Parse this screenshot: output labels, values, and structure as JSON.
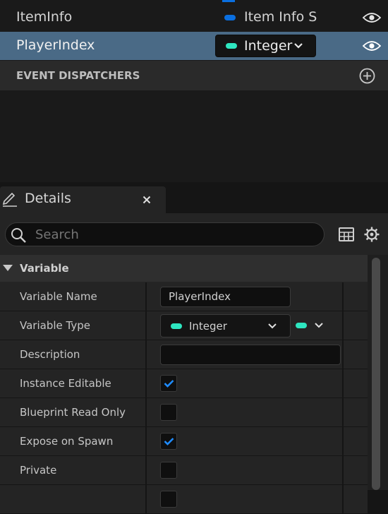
{
  "variables_list": {
    "rows": [
      {
        "name": "ItemInfo",
        "type": "Item Info S"
      },
      {
        "name": "PlayerIndex",
        "type": "Integer"
      }
    ],
    "section_label": "EVENT DISPATCHERS"
  },
  "details_tab": {
    "title": "Details"
  },
  "search": {
    "placeholder": "Search"
  },
  "variable_section": {
    "title": "Variable"
  },
  "properties": {
    "variable_name": {
      "label": "Variable Name",
      "value": "PlayerIndex"
    },
    "variable_type": {
      "label": "Variable Type",
      "value": "Integer"
    },
    "description": {
      "label": "Description",
      "value": ""
    },
    "instance_editable": {
      "label": "Instance Editable",
      "checked": true
    },
    "blueprint_read_only": {
      "label": "Blueprint Read Only",
      "checked": false
    },
    "expose_on_spawn": {
      "label": "Expose on Spawn",
      "checked": true
    },
    "private": {
      "label": "Private",
      "checked": false
    }
  },
  "colors": {
    "integer_pin": "#2ee6c0",
    "struct_pin": "#0a6fe0",
    "selected_row": "#4a6a86",
    "checkmark": "#1f8cff"
  }
}
